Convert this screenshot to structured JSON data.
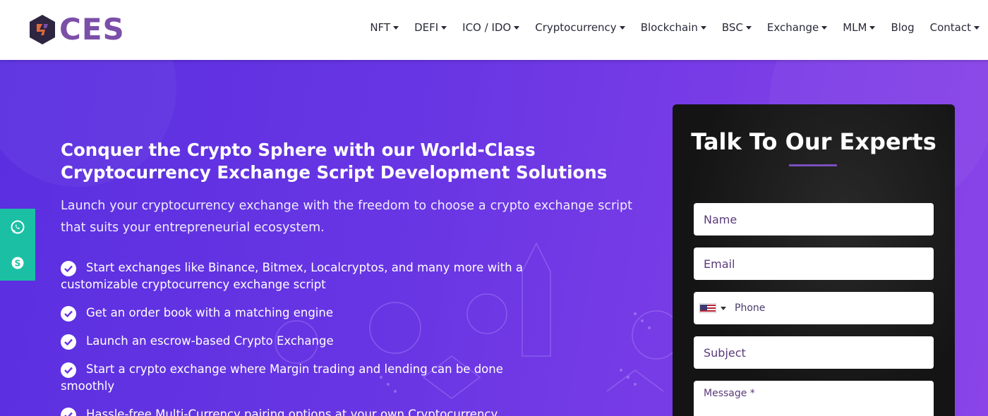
{
  "header": {
    "logo_text": "CES",
    "nav": [
      {
        "label": "NFT",
        "dropdown": true
      },
      {
        "label": "DEFI",
        "dropdown": true
      },
      {
        "label": "ICO / IDO",
        "dropdown": true
      },
      {
        "label": "Cryptocurrency",
        "dropdown": true
      },
      {
        "label": "Blockchain",
        "dropdown": true
      },
      {
        "label": "BSC",
        "dropdown": true
      },
      {
        "label": "Exchange",
        "dropdown": true
      },
      {
        "label": "MLM",
        "dropdown": true
      },
      {
        "label": "Blog",
        "dropdown": false
      },
      {
        "label": "Contact",
        "dropdown": true
      }
    ]
  },
  "hero": {
    "title": "Conquer the Crypto Sphere with our World-Class Cryptocurrency Exchange Script Development Solutions",
    "subtitle": "Launch your cryptocurrency exchange with the freedom to choose a crypto exchange script that suits your entrepreneurial ecosystem.",
    "features": [
      "Start exchanges like Binance, Bitmex, Localcryptos, and many more with a customizable cryptocurrency exchange script",
      "Get an order book with a matching engine",
      "Launch an escrow-based Crypto Exchange",
      "Start a crypto exchange where Margin trading and lending can be done smoothly",
      "Hassle-free Multi-Currency pairing options at your own Cryptocurrency"
    ]
  },
  "side_contact": {
    "icons": [
      "whatsapp-icon",
      "skype-icon"
    ],
    "color": "#1bc0a4"
  },
  "form": {
    "title": "Talk To Our Experts",
    "name_placeholder": "Name",
    "email_placeholder": "Email",
    "phone_placeholder": "Phone",
    "subject_placeholder": "Subject",
    "message_placeholder": "Message *"
  },
  "colors": {
    "brand": "#7b4fa8",
    "hero_start": "#5a2fe0",
    "hero_end": "#8a44e8",
    "form_bg": "#141414",
    "accent_teal": "#1bc0a4"
  }
}
